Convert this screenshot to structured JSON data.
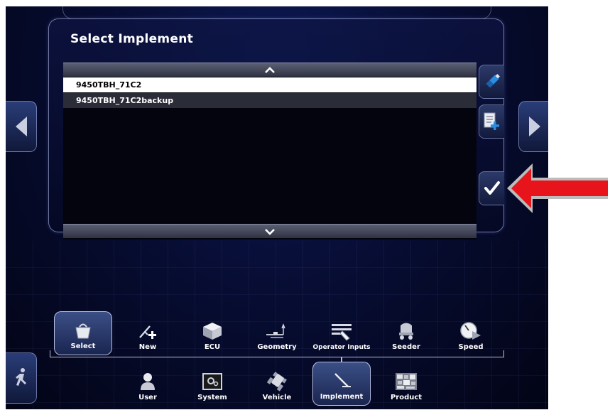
{
  "dialog": {
    "title": "Select Implement",
    "items": [
      {
        "label": "9450TBH_71C2",
        "selected": true
      },
      {
        "label": "9450TBH_71C2backup",
        "selected": false
      }
    ]
  },
  "side_actions": {
    "usb_icon": "usb-drive-icon",
    "add_icon": "add-document-icon",
    "confirm_icon": "checkmark-icon"
  },
  "menu_row1": [
    {
      "label": "Select",
      "icon": "select-basket-icon",
      "selected": true
    },
    {
      "label": "New",
      "icon": "new-implement-icon",
      "selected": false
    },
    {
      "label": "ECU",
      "icon": "ecu-box-icon",
      "selected": false
    },
    {
      "label": "Geometry",
      "icon": "geometry-icon",
      "selected": false
    },
    {
      "label": "Operator Inputs",
      "icon": "operator-inputs-icon",
      "selected": false
    },
    {
      "label": "Seeder",
      "icon": "seeder-icon",
      "selected": false
    },
    {
      "label": "Speed",
      "icon": "speed-icon",
      "selected": false
    }
  ],
  "menu_row2": [
    {
      "label": "User",
      "icon": "user-icon",
      "selected": false
    },
    {
      "label": "System",
      "icon": "system-icon",
      "selected": false
    },
    {
      "label": "Vehicle",
      "icon": "vehicle-icon",
      "selected": false
    },
    {
      "label": "Implement",
      "icon": "implement-icon",
      "selected": true
    },
    {
      "label": "Product",
      "icon": "product-icon",
      "selected": false
    }
  ],
  "colors": {
    "accent_red": "#e8141b",
    "selected_row_bg": "#ffffff",
    "panel_border": "#c8d2ff"
  }
}
